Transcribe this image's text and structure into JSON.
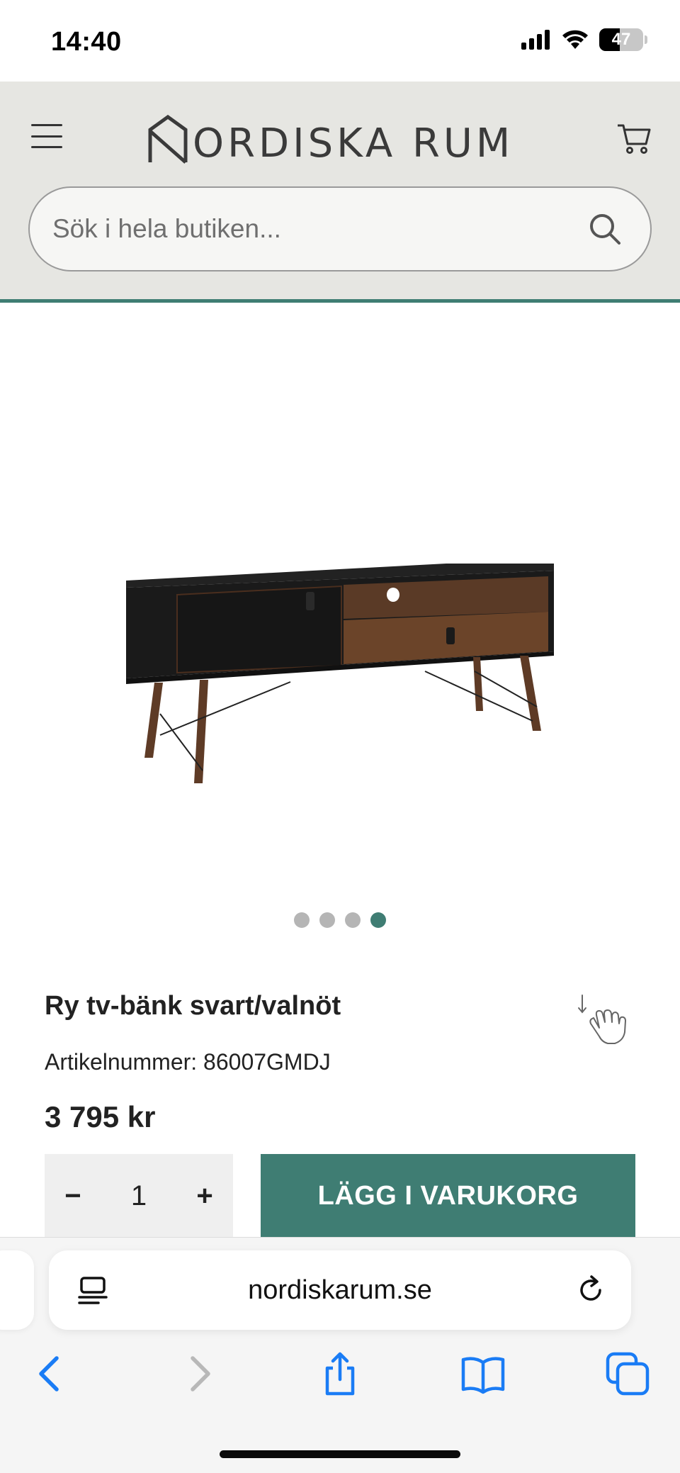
{
  "status_bar": {
    "time": "14:40",
    "battery": "47"
  },
  "header": {
    "logo_text": "ORDISKA RUM",
    "search_placeholder": "Sök i hela butiken..."
  },
  "gallery": {
    "image_alt": "Ry tv-bänk svart/valnöt",
    "slides": 4,
    "active_slide": 4
  },
  "product": {
    "title": "Ry tv-bänk svart/valnöt",
    "sku_label": "Artikelnummer:",
    "sku_value": "86007GMDJ",
    "price": "3 795 kr",
    "quantity": "1",
    "qty_minus": "−",
    "qty_plus": "+",
    "add_to_cart": "LÄGG I VARUKORG"
  },
  "browser": {
    "url": "nordiskarum.se"
  },
  "colors": {
    "accent": "#3f7d73",
    "header_bg": "#e6e6e2",
    "ios_blue": "#1a7cf5"
  },
  "icons": [
    "menu-icon",
    "cart-icon",
    "search-icon",
    "reader-icon",
    "reload-icon",
    "back-icon",
    "forward-icon",
    "share-icon",
    "bookmarks-icon",
    "tabs-icon",
    "hand-swipe-icon"
  ]
}
